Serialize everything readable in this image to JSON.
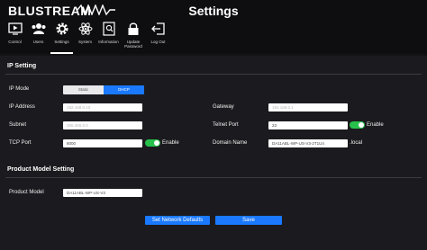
{
  "app": {
    "logo_text": "BLUSTREAM",
    "title": "Settings"
  },
  "nav": [
    {
      "label": "Control",
      "icon": "tv-play-icon"
    },
    {
      "label": "Users",
      "icon": "users-icon"
    },
    {
      "label": "Settings",
      "icon": "gear-icon"
    },
    {
      "label": "System",
      "icon": "atom-icon"
    },
    {
      "label": "Information",
      "icon": "document-search-icon"
    },
    {
      "label": "Update Password",
      "icon": "lock-icon"
    },
    {
      "label": "Log Out",
      "icon": "logout-icon"
    }
  ],
  "ip_setting": {
    "title": "IP Setting",
    "ip_mode": {
      "label": "IP Mode",
      "options": [
        "Static",
        "DHCP"
      ],
      "selected": "DHCP"
    },
    "ip_address": {
      "label": "IP Address",
      "placeholder": "192.168.0.10"
    },
    "gateway": {
      "label": "Gateway",
      "placeholder": "192.168.0.1"
    },
    "subnet": {
      "label": "Subnet",
      "placeholder": "255.255.0.0"
    },
    "telnet_port": {
      "label": "Telnet Port",
      "value": "23",
      "enable_label": "Enable"
    },
    "tcp_port": {
      "label": "TCP Port",
      "value": "8000",
      "enable_label": "Enable"
    },
    "domain_name": {
      "label": "Domain Name",
      "value": "DA11ABL-WP-US-V3-2T1U4",
      "suffix": ".local"
    }
  },
  "product_model": {
    "title": "Product Model Setting",
    "label": "Product Model",
    "value": "DA11ABL-WP-US-V3"
  },
  "actions": {
    "set_defaults": "Set Network Defaults",
    "save": "Save"
  },
  "colors": {
    "accent": "#1a79ff",
    "toggle_on": "#27c04a",
    "background": "#131316"
  }
}
